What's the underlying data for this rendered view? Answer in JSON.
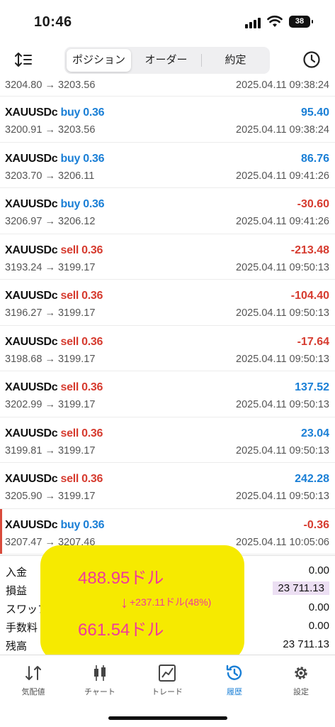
{
  "status_bar": {
    "time": "10:46",
    "battery": "38"
  },
  "tabs": [
    {
      "label": "ポジション"
    },
    {
      "label": "オーダー"
    },
    {
      "label": "約定"
    }
  ],
  "partial_row": {
    "prices": "3204.80 → 3203.56",
    "time": "2025.04.11 09:38:24"
  },
  "deals": [
    {
      "symbol": "XAUUSDc",
      "side": "buy 0.36",
      "prices": "3200.91 → 3203.56",
      "profit": "95.40",
      "time": "2025.04.11 09:38:24"
    },
    {
      "symbol": "XAUUSDc",
      "side": "buy 0.36",
      "prices": "3203.70 → 3206.11",
      "profit": "86.76",
      "time": "2025.04.11 09:41:26"
    },
    {
      "symbol": "XAUUSDc",
      "side": "buy 0.36",
      "prices": "3206.97 → 3206.12",
      "profit": "-30.60",
      "time": "2025.04.11 09:41:26"
    },
    {
      "symbol": "XAUUSDc",
      "side": "sell 0.36",
      "prices": "3193.24 → 3199.17",
      "profit": "-213.48",
      "time": "2025.04.11 09:50:13"
    },
    {
      "symbol": "XAUUSDc",
      "side": "sell 0.36",
      "prices": "3196.27 → 3199.17",
      "profit": "-104.40",
      "time": "2025.04.11 09:50:13"
    },
    {
      "symbol": "XAUUSDc",
      "side": "sell 0.36",
      "prices": "3198.68 → 3199.17",
      "profit": "-17.64",
      "time": "2025.04.11 09:50:13"
    },
    {
      "symbol": "XAUUSDc",
      "side": "sell 0.36",
      "prices": "3202.99 → 3199.17",
      "profit": "137.52",
      "time": "2025.04.11 09:50:13"
    },
    {
      "symbol": "XAUUSDc",
      "side": "sell 0.36",
      "prices": "3199.81 → 3199.17",
      "profit": "23.04",
      "time": "2025.04.11 09:50:13"
    },
    {
      "symbol": "XAUUSDc",
      "side": "sell 0.36",
      "prices": "3205.90 → 3199.17",
      "profit": "242.28",
      "time": "2025.04.11 09:50:13"
    },
    {
      "symbol": "XAUUSDc",
      "side": "buy 0.36",
      "prices": "3207.47 → 3207.46",
      "profit": "-0.36",
      "time": "2025.04.11 10:05:06"
    }
  ],
  "summary": {
    "deposit_label": "入金",
    "deposit_value": "0.00",
    "profit_label": "損益",
    "profit_value": "23 711.13",
    "swap_label": "スワップ",
    "swap_value": "0.00",
    "fee_label": "手数料",
    "fee_value": "0.00",
    "balance_label": "残高",
    "balance_value": "23 711.13"
  },
  "overlay": {
    "before": "488.95ドル",
    "change": "+237.11ドル(48%)",
    "change_arrow": "↓",
    "after": "661.54ドル"
  },
  "nav": [
    {
      "label": "気配値"
    },
    {
      "label": "チャート"
    },
    {
      "label": "トレード"
    },
    {
      "label": "履歴"
    },
    {
      "label": "設定"
    }
  ],
  "colors": {
    "buy": "#1a7fd6",
    "sell": "#d63b2f",
    "profit_positive": "#1a7fd6",
    "profit_negative": "#d63b2f",
    "nav_active": "#1a7fd6",
    "overlay_bg": "#f6ea00",
    "overlay_text": "#f03a9c",
    "highlight_bg": "#ecdff3"
  },
  "icons": {
    "sort": "sort-icon",
    "history": "clock-icon",
    "nav": [
      "quotes-icon",
      "chart-icon",
      "trade-icon",
      "history-icon",
      "settings-icon"
    ]
  }
}
